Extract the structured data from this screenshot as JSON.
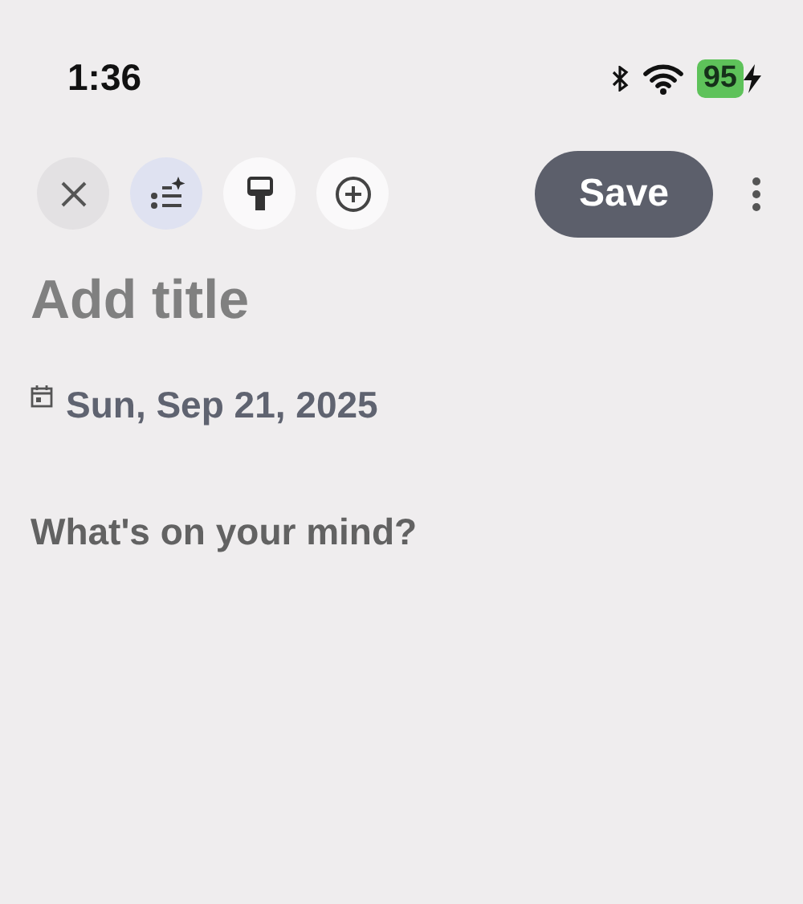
{
  "status_bar": {
    "time": "1:36",
    "battery": "95"
  },
  "toolbar": {
    "buttons": [
      {
        "kind": "close",
        "selected": false
      },
      {
        "kind": "ai-list",
        "selected": true
      },
      {
        "kind": "brush",
        "selected": false
      },
      {
        "kind": "add",
        "selected": false
      }
    ],
    "save": "Save"
  },
  "title": {
    "placeholder": "Add title"
  },
  "date": "Sun, Sep 21, 2025",
  "body": {
    "placeholder": "What's on your mind?"
  }
}
